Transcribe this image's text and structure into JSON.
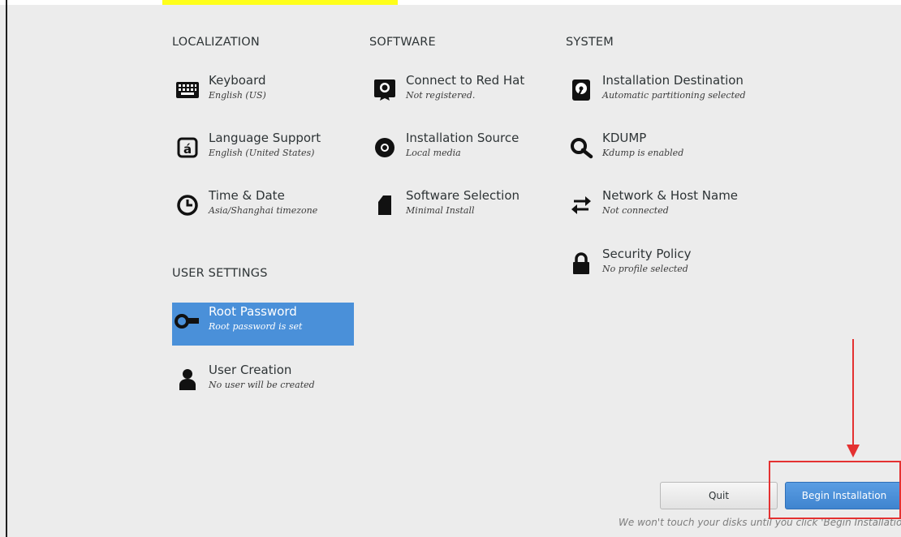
{
  "sections": {
    "localization": "LOCALIZATION",
    "software": "SOFTWARE",
    "system": "SYSTEM",
    "user_settings": "USER SETTINGS"
  },
  "spokes": {
    "keyboard": {
      "title": "Keyboard",
      "status": "English (US)",
      "icon": "keyboard-icon"
    },
    "language": {
      "title": "Language Support",
      "status": "English (United States)",
      "icon": "language-icon"
    },
    "time": {
      "title": "Time & Date",
      "status": "Asia/Shanghai timezone",
      "icon": "clock-icon"
    },
    "redhat": {
      "title": "Connect to Red Hat",
      "status": "Not registered.",
      "icon": "redhat-icon"
    },
    "source": {
      "title": "Installation Source",
      "status": "Local media",
      "icon": "disc-icon"
    },
    "software": {
      "title": "Software Selection",
      "status": "Minimal Install",
      "icon": "package-icon"
    },
    "destination": {
      "title": "Installation Destination",
      "status": "Automatic partitioning selected",
      "icon": "hard-disk-icon"
    },
    "kdump": {
      "title": "KDUMP",
      "status": "Kdump is enabled",
      "icon": "magnifier-icon"
    },
    "network": {
      "title": "Network & Host Name",
      "status": "Not connected",
      "icon": "network-arrows-icon"
    },
    "security": {
      "title": "Security Policy",
      "status": "No profile selected",
      "icon": "lock-icon"
    },
    "root": {
      "title": "Root Password",
      "status": "Root password is set",
      "icon": "key-icon"
    },
    "user": {
      "title": "User Creation",
      "status": "No user will be created",
      "icon": "user-icon"
    }
  },
  "buttons": {
    "quit": "Quit",
    "begin": "Begin Installation"
  },
  "footer_note": "We won't touch your disks until you click 'Begin Installation'.",
  "colors": {
    "background": "#ececec",
    "selected": "#4a90d9",
    "primary_button": "#4a90d9",
    "annotation": "#e43131",
    "highlight": "#ffff1a"
  }
}
